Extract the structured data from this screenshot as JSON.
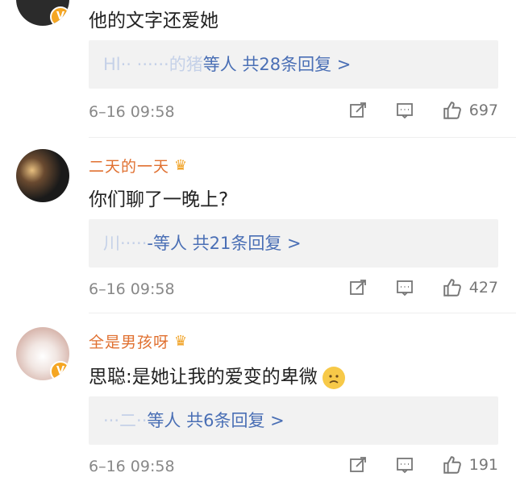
{
  "comments": [
    {
      "username": "",
      "text": "他的文字还爱她",
      "reply_preview": {
        "names": "Hl·· ······的猪",
        "suffix": "等人",
        "count": "共28条回复 >"
      },
      "time": "6–16 09:58",
      "likes": "697"
    },
    {
      "username": "二天的一天",
      "text": "你们聊了一晚上?",
      "reply_preview": {
        "names": "川·····",
        "suffix": "-等人",
        "count": "共21条回复 >"
      },
      "time": "6–16 09:58",
      "likes": "427"
    },
    {
      "username": "全是男孩呀",
      "text": "思聪:是她让我的爱变的卑微",
      "reply_preview": {
        "names": "···二··",
        "suffix": "等人",
        "count": "共6条回复 >"
      },
      "time": "6–16 09:58",
      "likes": "191"
    }
  ],
  "icons": {
    "share": "share-icon",
    "comment": "comment-icon",
    "like": "thumbs-up-icon",
    "crown": "crown-icon",
    "verified": "verified-badge-icon",
    "emoji": "sad-emoji-icon"
  },
  "colors": {
    "link": "#4a6fb5",
    "username": "#e07030",
    "meta": "#888888",
    "reply_bg": "#f2f2f2"
  }
}
